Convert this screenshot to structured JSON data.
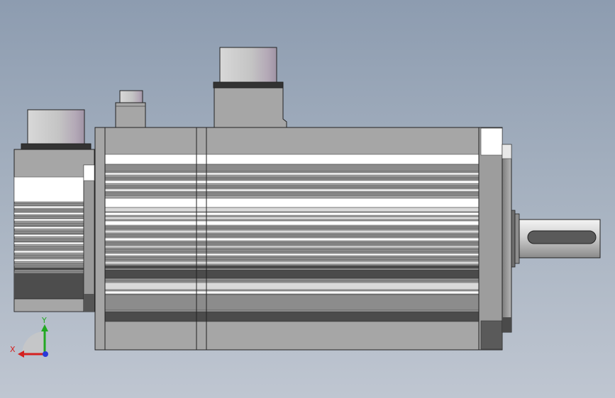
{
  "view": {
    "background_top": "#8d9cb0",
    "background_bottom": "#bfc6d1"
  },
  "model": {
    "body_color": "#a6a6a6",
    "stripe_light": "#ffffff",
    "stripe_dark": "#4b4b4b",
    "cap_color": "#c8c6cc",
    "edge_color": "#222222"
  },
  "triad": {
    "x_label": "X",
    "y_label": "Y",
    "x_color": "#d42020",
    "y_color": "#22a822",
    "z_color": "#2a3ad8"
  }
}
